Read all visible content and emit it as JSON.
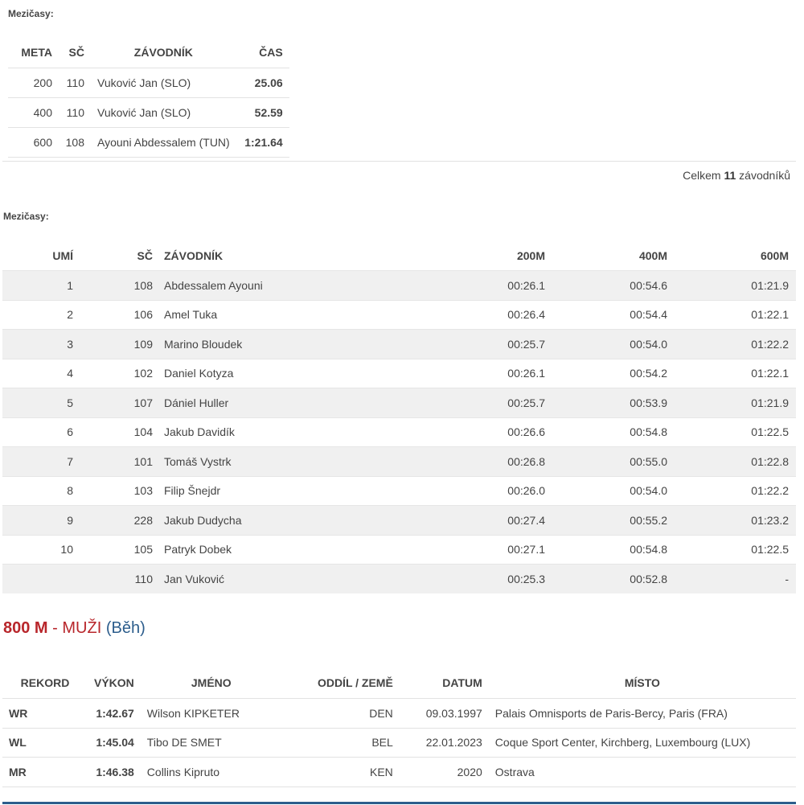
{
  "split1": {
    "label": "Mezičasy:",
    "headers": [
      "META",
      "SČ",
      "ZÁVODNÍK",
      "ČAS"
    ],
    "rows": [
      {
        "meta": "200",
        "sc": "110",
        "name": "Vuković Jan (SLO)",
        "time": "25.06"
      },
      {
        "meta": "400",
        "sc": "110",
        "name": "Vuković Jan (SLO)",
        "time": "52.59"
      },
      {
        "meta": "600",
        "sc": "108",
        "name": "Ayouni Abdessalem (TUN)",
        "time": "1:21.64"
      }
    ]
  },
  "total": {
    "prefix": "Celkem",
    "count": "11",
    "suffix": "závodníků"
  },
  "split2": {
    "label": "Mezičasy:",
    "headers": [
      "UMÍ",
      "SČ",
      "ZÁVODNÍK",
      "200M",
      "400M",
      "600M"
    ],
    "rows": [
      {
        "rank": "1",
        "sc": "108",
        "name": "Abdessalem Ayouni",
        "t200": "00:26.1",
        "t400": "00:54.6",
        "t600": "01:21.9"
      },
      {
        "rank": "2",
        "sc": "106",
        "name": "Amel Tuka",
        "t200": "00:26.4",
        "t400": "00:54.4",
        "t600": "01:22.1"
      },
      {
        "rank": "3",
        "sc": "109",
        "name": "Marino Bloudek",
        "t200": "00:25.7",
        "t400": "00:54.0",
        "t600": "01:22.2"
      },
      {
        "rank": "4",
        "sc": "102",
        "name": "Daniel Kotyza",
        "t200": "00:26.1",
        "t400": "00:54.2",
        "t600": "01:22.1"
      },
      {
        "rank": "5",
        "sc": "107",
        "name": "Dániel Huller",
        "t200": "00:25.7",
        "t400": "00:53.9",
        "t600": "01:21.9"
      },
      {
        "rank": "6",
        "sc": "104",
        "name": "Jakub Davidík",
        "t200": "00:26.6",
        "t400": "00:54.8",
        "t600": "01:22.5"
      },
      {
        "rank": "7",
        "sc": "101",
        "name": "Tomáš Vystrk",
        "t200": "00:26.8",
        "t400": "00:55.0",
        "t600": "01:22.8"
      },
      {
        "rank": "8",
        "sc": "103",
        "name": "Filip Šnejdr",
        "t200": "00:26.0",
        "t400": "00:54.0",
        "t600": "01:22.2"
      },
      {
        "rank": "9",
        "sc": "228",
        "name": "Jakub Dudycha",
        "t200": "00:27.4",
        "t400": "00:55.2",
        "t600": "01:23.2"
      },
      {
        "rank": "10",
        "sc": "105",
        "name": "Patryk Dobek",
        "t200": "00:27.1",
        "t400": "00:54.8",
        "t600": "01:22.5"
      },
      {
        "rank": "",
        "sc": "110",
        "name": "Jan Vuković",
        "t200": "00:25.3",
        "t400": "00:52.8",
        "t600": "-"
      }
    ]
  },
  "event": {
    "distance": "800 M",
    "separator": " - ",
    "category": "MUŽI",
    "type": "(Běh)"
  },
  "records": {
    "headers": [
      "REKORD",
      "VÝKON",
      "JMÉNO",
      "ODDÍL / ZEMĚ",
      "DATUM",
      "MÍSTO"
    ],
    "rows": [
      {
        "rekord": "WR",
        "vykon": "1:42.67",
        "jmeno": "Wilson KIPKETER",
        "oddil": "DEN",
        "datum": "09.03.1997",
        "misto": "Palais Omnisports de Paris-Bercy, Paris (FRA)"
      },
      {
        "rekord": "WL",
        "vykon": "1:45.04",
        "jmeno": "Tibo DE SMET",
        "oddil": "BEL",
        "datum": "22.01.2023",
        "misto": "Coque Sport Center, Kirchberg, Luxembourg (LUX)"
      },
      {
        "rekord": "MR",
        "vykon": "1:46.38",
        "jmeno": "Collins Kipruto",
        "oddil": "KEN",
        "datum": "2020",
        "misto": "Ostrava"
      }
    ]
  },
  "colors": {
    "accent_red": "#b8262b",
    "accent_blue": "#2c5d8c",
    "stripe": "#f0f0f0"
  }
}
